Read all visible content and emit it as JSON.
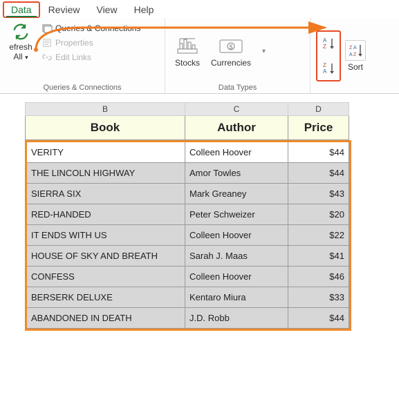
{
  "ribbon": {
    "tabs": [
      "Data",
      "Review",
      "View",
      "Help"
    ],
    "active_tab": "Data",
    "groups": {
      "queries": {
        "label": "Queries & Connections",
        "refresh_line1": "efresh",
        "refresh_line2": "All",
        "items": {
          "qc": "Queries & Connections",
          "props": "Properties",
          "edit_links": "Edit Links"
        }
      },
      "datatypes": {
        "label": "Data Types",
        "stocks": "Stocks",
        "currencies": "Currencies"
      },
      "sort": {
        "label": "Sort"
      }
    }
  },
  "columns": {
    "b": "B",
    "c": "C",
    "d": "D"
  },
  "headers": {
    "book": "Book",
    "author": "Author",
    "price": "Price"
  },
  "rows": [
    {
      "book": "VERITY",
      "author": "Colleen Hoover",
      "price": "$44"
    },
    {
      "book": "THE LINCOLN HIGHWAY",
      "author": "Amor Towles",
      "price": "$44"
    },
    {
      "book": "SIERRA SIX",
      "author": "Mark Greaney",
      "price": "$43"
    },
    {
      "book": "RED-HANDED",
      "author": "Peter Schweizer",
      "price": "$20"
    },
    {
      "book": "IT ENDS WITH US",
      "author": "Colleen Hoover",
      "price": "$22"
    },
    {
      "book": "HOUSE OF SKY AND BREATH",
      "author": "Sarah J. Maas",
      "price": "$41"
    },
    {
      "book": "CONFESS",
      "author": "Colleen Hoover",
      "price": "$46"
    },
    {
      "book": "BERSERK DELUXE",
      "author": "Kentaro Miura",
      "price": "$33"
    },
    {
      "book": "ABANDONED IN DEATH",
      "author": "J.D. Robb",
      "price": "$44"
    }
  ]
}
